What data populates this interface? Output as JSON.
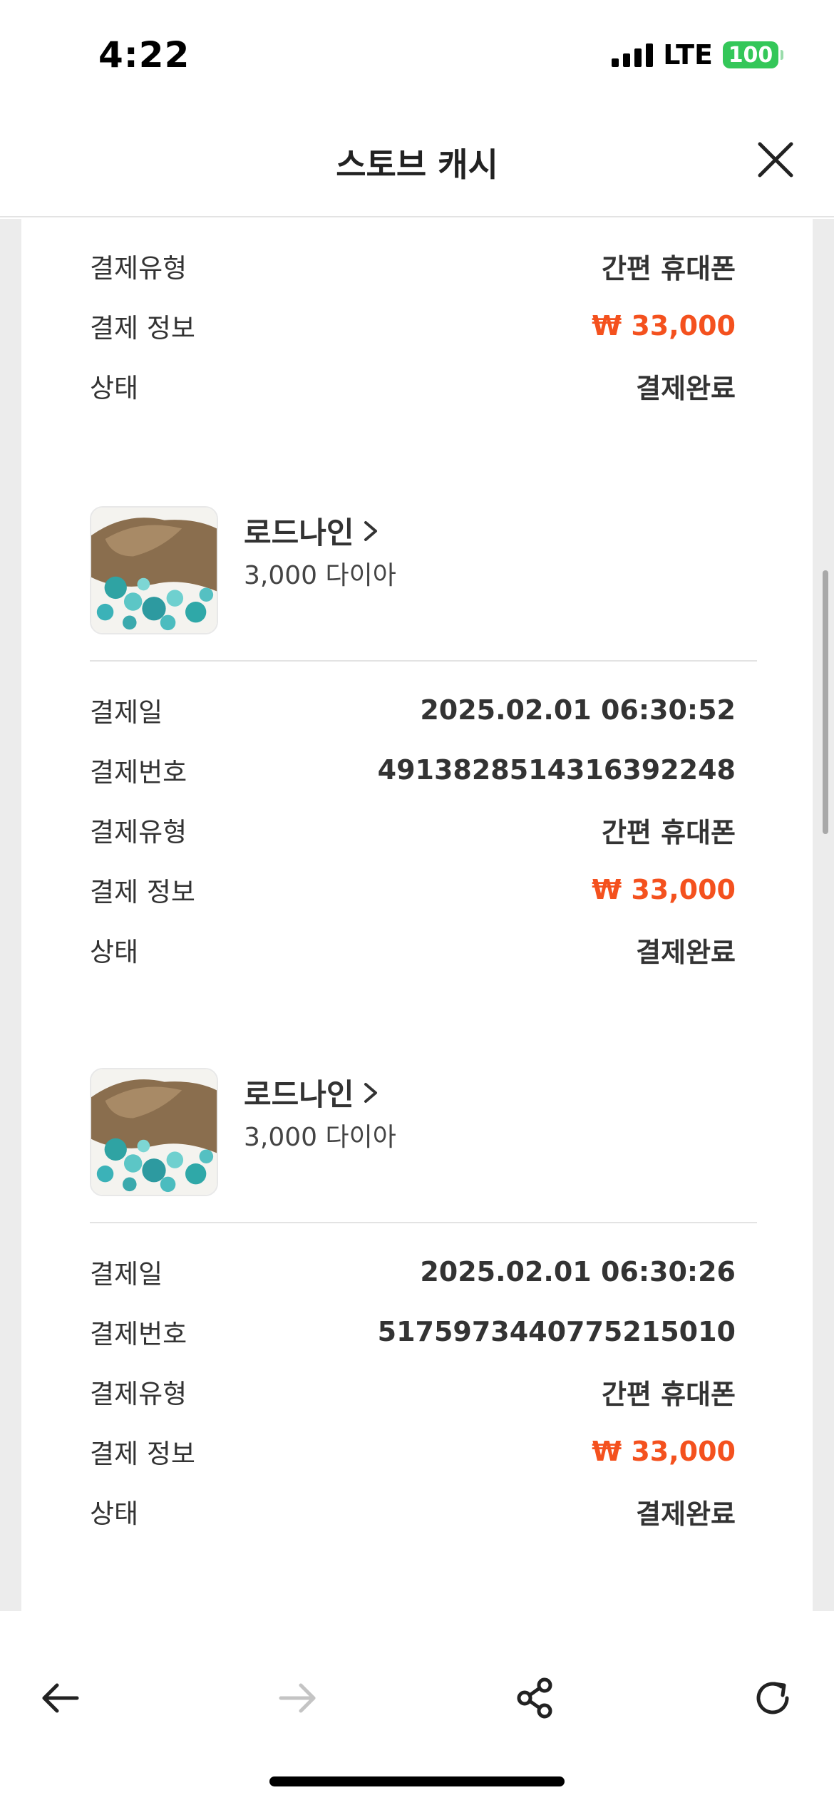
{
  "status_bar": {
    "time": "4:22",
    "network": "LTE",
    "battery": "100"
  },
  "header": {
    "title": "스토브 캐시",
    "close_icon": "close-icon"
  },
  "colors": {
    "price": "#f4511e",
    "battery": "#34c759",
    "background": "#ececec"
  },
  "entries": [
    {
      "fields": [
        {
          "label": "결제유형",
          "value": "간편 휴대폰"
        },
        {
          "label": "결제 정보",
          "value": "₩ 33,000"
        },
        {
          "label": "상태",
          "value": "결제완료"
        }
      ]
    },
    {
      "product": {
        "name": "로드나인",
        "item": "3,000 다이아"
      },
      "fields": [
        {
          "label": "결제일",
          "value": "2025.02.01 06:30:52"
        },
        {
          "label": "결제번호",
          "value": "4913828514316392248"
        },
        {
          "label": "결제유형",
          "value": "간편 휴대폰"
        },
        {
          "label": "결제 정보",
          "value": "₩ 33,000"
        },
        {
          "label": "상태",
          "value": "결제완료"
        }
      ]
    },
    {
      "product": {
        "name": "로드나인",
        "item": "3,000 다이아"
      },
      "fields": [
        {
          "label": "결제일",
          "value": "2025.02.01 06:30:26"
        },
        {
          "label": "결제번호",
          "value": "5175973440775215010"
        },
        {
          "label": "결제유형",
          "value": "간편 휴대폰"
        },
        {
          "label": "결제 정보",
          "value": "₩ 33,000"
        },
        {
          "label": "상태",
          "value": "결제완료"
        }
      ]
    }
  ],
  "toolbar": {
    "icons": [
      "back-arrow-icon",
      "forward-arrow-icon",
      "share-icon",
      "refresh-icon"
    ]
  }
}
